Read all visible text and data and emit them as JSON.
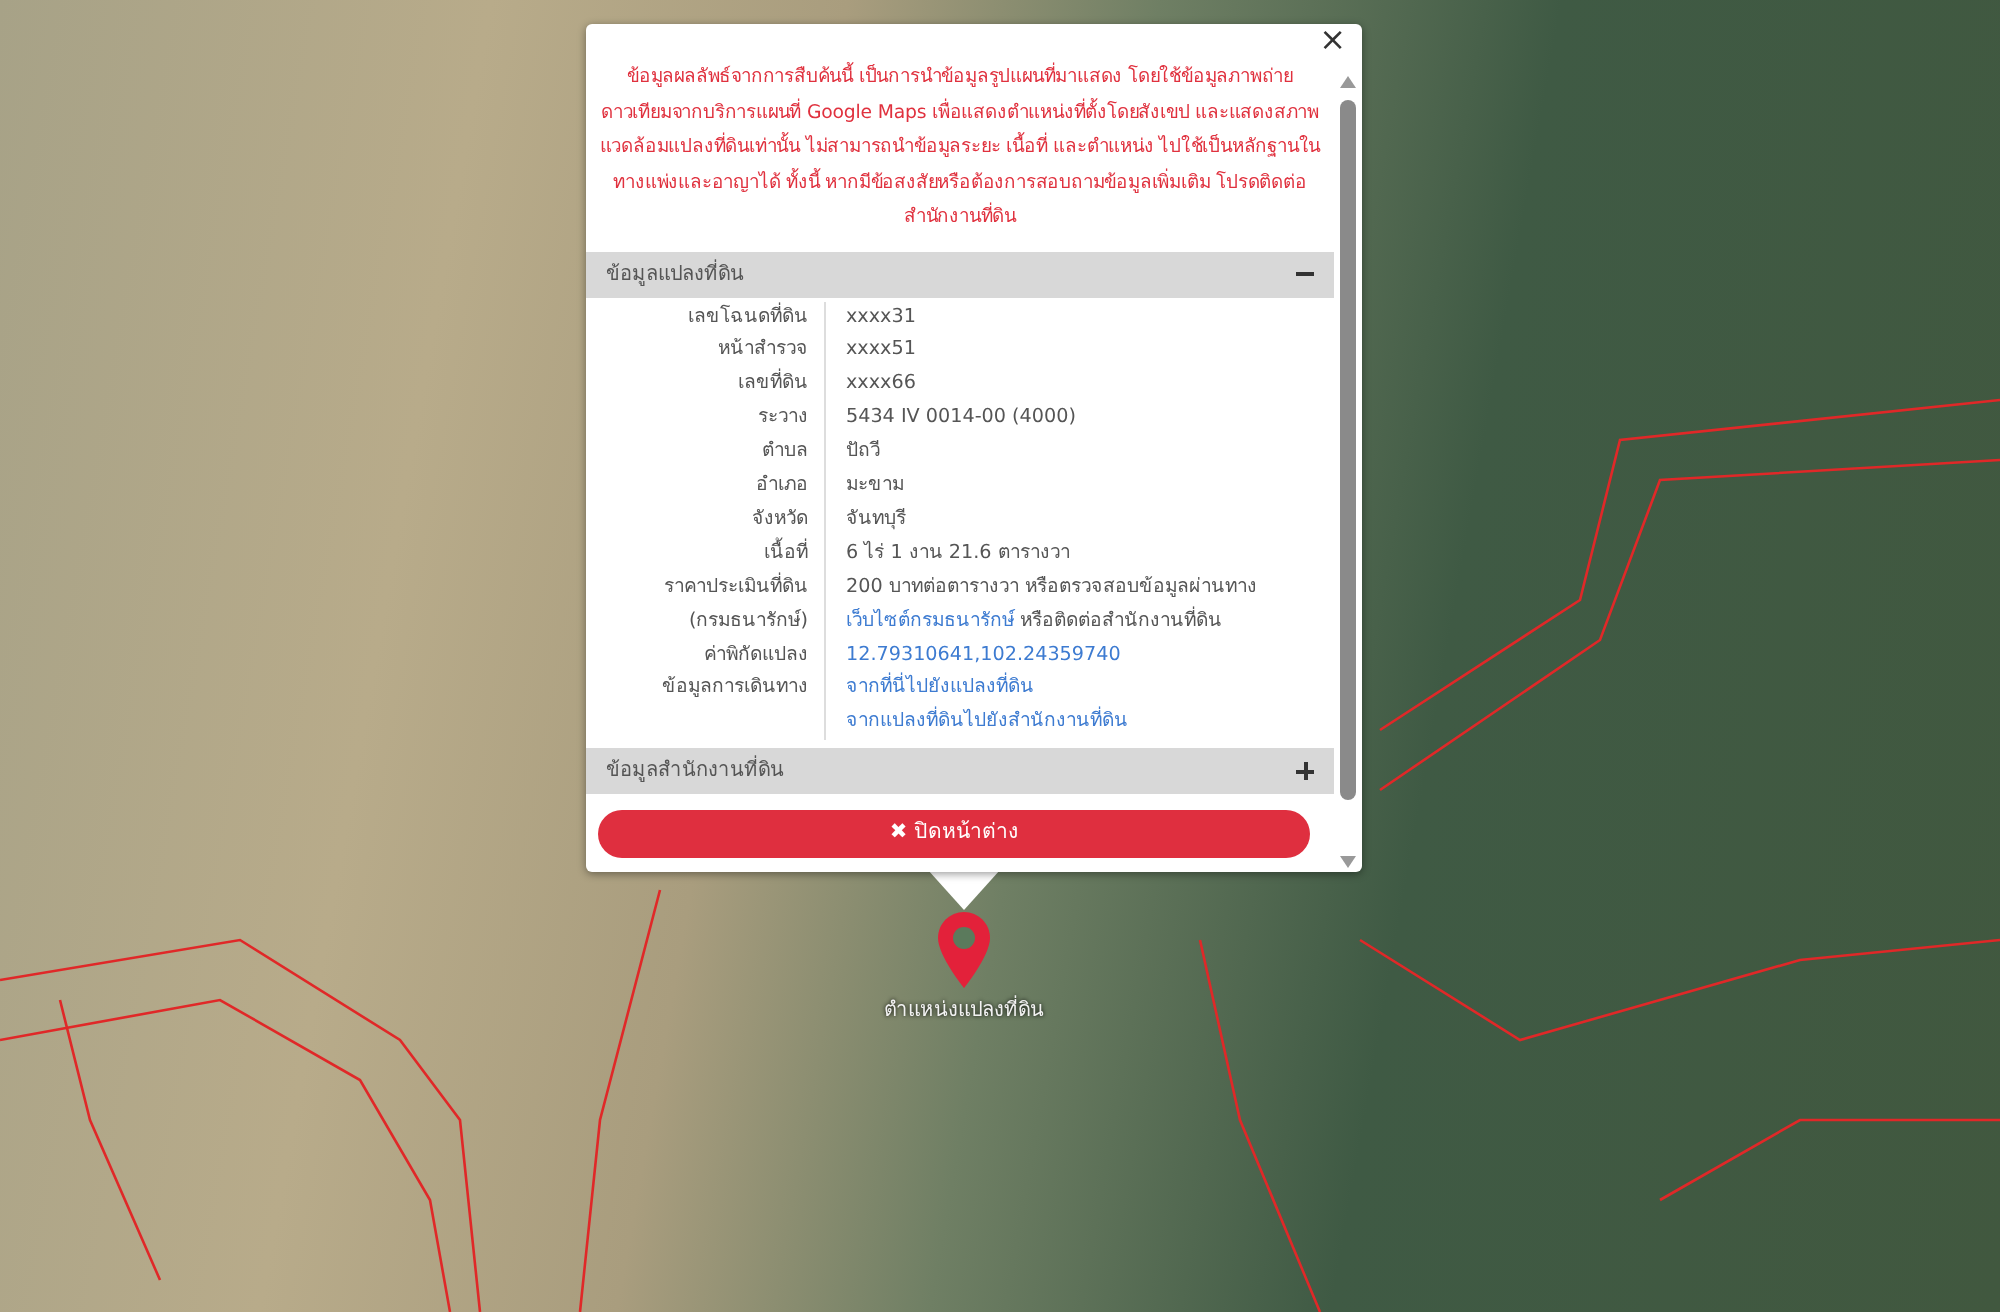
{
  "map": {
    "marker_label": "ตำแหน่งแปลงที่ดิน"
  },
  "popup": {
    "close": "×",
    "notice": "ข้อมูลผลลัพธ์จากการสืบค้นนี้ เป็นการนำข้อมูลรูปแผนที่มาแสดง โดยใช้ข้อมูลภาพถ่ายดาวเทียมจากบริการแผนที่ Google Maps เพื่อแสดงตำแหน่งที่ตั้งโดยสังเขป และแสดงสภาพแวดล้อมแปลงที่ดินเท่านั้น ไม่สามารถนำข้อมูลระยะ เนื้อที่ และตำแหน่ง ไปใช้เป็นหลักฐานในทางแพ่งและอาญาได้ ทั้งนี้ หากมีข้อสงสัยหรือต้องการสอบถามข้อมูลเพิ่มเติม โปรดติดต่อสำนักงานที่ดิน",
    "sections": [
      {
        "title": "ข้อมูลแปลงที่ดิน",
        "expanded": true,
        "rows": [
          {
            "label": "เลขโฉนดที่ดิน",
            "lines": [
              [
                {
                  "kind": "text",
                  "text": "xxxx31"
                }
              ]
            ]
          },
          {
            "label": "หน้าสำรวจ",
            "lines": [
              [
                {
                  "kind": "text",
                  "text": "xxxx51"
                }
              ]
            ]
          },
          {
            "label": "เลขที่ดิน",
            "lines": [
              [
                {
                  "kind": "text",
                  "text": "xxxx66"
                }
              ]
            ]
          },
          {
            "label": "ระวาง",
            "lines": [
              [
                {
                  "kind": "text",
                  "text": "5434 IV 0014-00 (4000)"
                }
              ]
            ]
          },
          {
            "label": "ตำบล",
            "lines": [
              [
                {
                  "kind": "text",
                  "text": "ปัถวี"
                }
              ]
            ]
          },
          {
            "label": "อำเภอ",
            "lines": [
              [
                {
                  "kind": "text",
                  "text": "มะขาม"
                }
              ]
            ]
          },
          {
            "label": "จังหวัด",
            "lines": [
              [
                {
                  "kind": "text",
                  "text": "จันทบุรี"
                }
              ]
            ]
          },
          {
            "label": "เนื้อที่",
            "lines": [
              [
                {
                  "kind": "text",
                  "text": "6 ไร่ 1 งาน 21.6 ตารางวา"
                }
              ]
            ]
          },
          {
            "label": "ราคาประเมินที่ดิน",
            "lines": [
              [
                {
                  "kind": "text",
                  "text": "200 บาทต่อตารางวา หรือตรวจสอบข้อมูลผ่านทาง"
                }
              ]
            ]
          },
          {
            "label": "(กรมธนารักษ์)",
            "lines": [
              [
                {
                  "kind": "link",
                  "text": "เว็บไซต์กรมธนารักษ์"
                },
                {
                  "kind": "text",
                  "text": "หรือติดต่อสำนักงานที่ดิน"
                }
              ]
            ]
          },
          {
            "label": "ค่าพิกัดแปลง",
            "lines": [
              [
                {
                  "kind": "link",
                  "text": "12.79310641,102.24359740"
                }
              ]
            ]
          },
          {
            "label": "ข้อมูลการเดินทาง",
            "lines": [
              [
                {
                  "kind": "link",
                  "text": "จากที่นี่ไปยังแปลงที่ดิน"
                }
              ],
              [
                {
                  "kind": "link",
                  "text": "จากแปลงที่ดินไปยังสำนักงานที่ดิน"
                }
              ]
            ]
          }
        ]
      },
      {
        "title": "ข้อมูลสำนักงานที่ดิน",
        "expanded": false
      }
    ],
    "close_button": {
      "icon": "✖",
      "label": "ปิดหน้าต่าง"
    }
  }
}
